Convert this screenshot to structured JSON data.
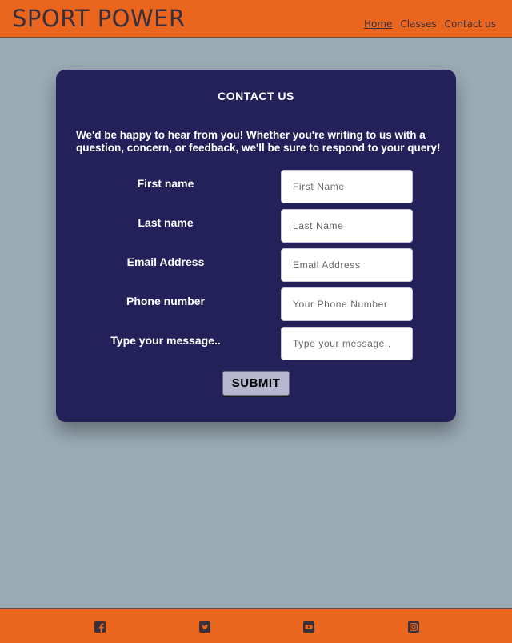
{
  "header": {
    "brand": "SPORT POWER",
    "nav": [
      {
        "label": "Home",
        "active": true
      },
      {
        "label": "Classes",
        "active": false
      },
      {
        "label": "Contact us",
        "active": false
      }
    ]
  },
  "contact": {
    "title": "CONTACT US",
    "intro": "We'd be happy to hear from you! Whether you're writing to us with a question, concern, or feedback, we'll be sure to respond to your query!",
    "fields": [
      {
        "label": "First name",
        "placeholder": "First Name",
        "value": ""
      },
      {
        "label": "Last name",
        "placeholder": "Last Name",
        "value": ""
      },
      {
        "label": "Email Address",
        "placeholder": "Email Address",
        "value": ""
      },
      {
        "label": "Phone number",
        "placeholder": "Your Phone Number",
        "value": ""
      },
      {
        "label": "Type your message..",
        "placeholder": "Type your message..",
        "value": ""
      }
    ],
    "submit_label": "SUBMIT"
  },
  "footer": {
    "social": [
      "facebook-icon",
      "twitter-icon",
      "youtube-icon",
      "instagram-icon"
    ]
  },
  "colors": {
    "accent": "#ea651d",
    "card": "#23205a",
    "background": "#9aabb5",
    "button": "#b6b6cf"
  }
}
